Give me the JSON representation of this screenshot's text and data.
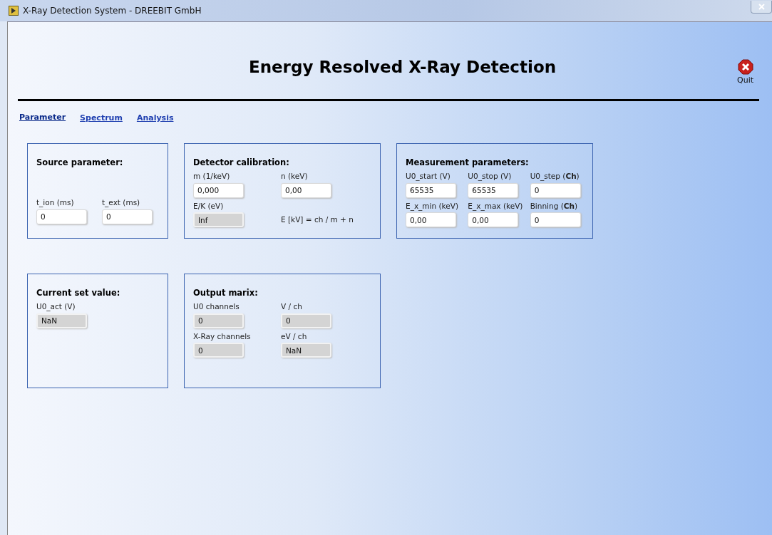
{
  "window": {
    "title": "X-Ray Detection System - DREEBIT GmbH"
  },
  "heading": "Energy Resolved X-Ray Detection",
  "quit_button": {
    "label": "Quit"
  },
  "tabs": [
    {
      "label": "Parameter",
      "selected": true
    },
    {
      "label": "Spectrum",
      "selected": false
    },
    {
      "label": "Analysis",
      "selected": false
    }
  ],
  "panel_rows": [
    [
      {
        "title": "Source parameter:",
        "rows": [
          [
            {
              "kind": "input",
              "label": "t_ion (ms)",
              "value": "0"
            },
            {
              "kind": "input",
              "label": "t_ext (ms)",
              "value": "0"
            }
          ]
        ]
      },
      {
        "title": "Detector calibration:",
        "rows": [
          [
            {
              "kind": "input",
              "label": "m (1/keV)",
              "value": "0,000"
            },
            {
              "kind": "input",
              "label": "n (keV)",
              "value": "0,00"
            }
          ],
          [
            {
              "kind": "indicator",
              "label": "E/K (eV)",
              "value": "Inf"
            },
            {
              "kind": "formula",
              "text": "E [kV] = ch / m + n"
            }
          ]
        ]
      },
      {
        "title": "Measurement parameters:",
        "rows": [
          [
            {
              "kind": "input",
              "label": "U0_start (V)",
              "value": "65535"
            },
            {
              "kind": "input",
              "label": "U0_stop (V)",
              "value": "65535"
            },
            {
              "kind": "input",
              "label": "U0_step (**Ch**)",
              "value": "0"
            }
          ],
          [
            {
              "kind": "input",
              "label": "E_x_min (keV)",
              "value": "0,00"
            },
            {
              "kind": "input",
              "label": "E_x_max (keV)",
              "value": "0,00"
            },
            {
              "kind": "input",
              "label": "Binning (**Ch**)",
              "value": "0"
            }
          ]
        ]
      }
    ],
    [
      {
        "title": "Current set value:",
        "rows": [
          [
            {
              "kind": "indicator",
              "label": "U0_act (V)",
              "value": "NaN"
            }
          ]
        ]
      },
      {
        "title": "Output marix:",
        "rows": [
          [
            {
              "kind": "indicator",
              "label": "U0 channels",
              "value": "0"
            },
            {
              "kind": "indicator",
              "label": "V / ch",
              "value": "0"
            }
          ],
          [
            {
              "kind": "indicator",
              "label": "X-Ray channels",
              "value": "0"
            },
            {
              "kind": "indicator",
              "label": "eV / ch",
              "value": "NaN"
            }
          ]
        ]
      }
    ]
  ]
}
